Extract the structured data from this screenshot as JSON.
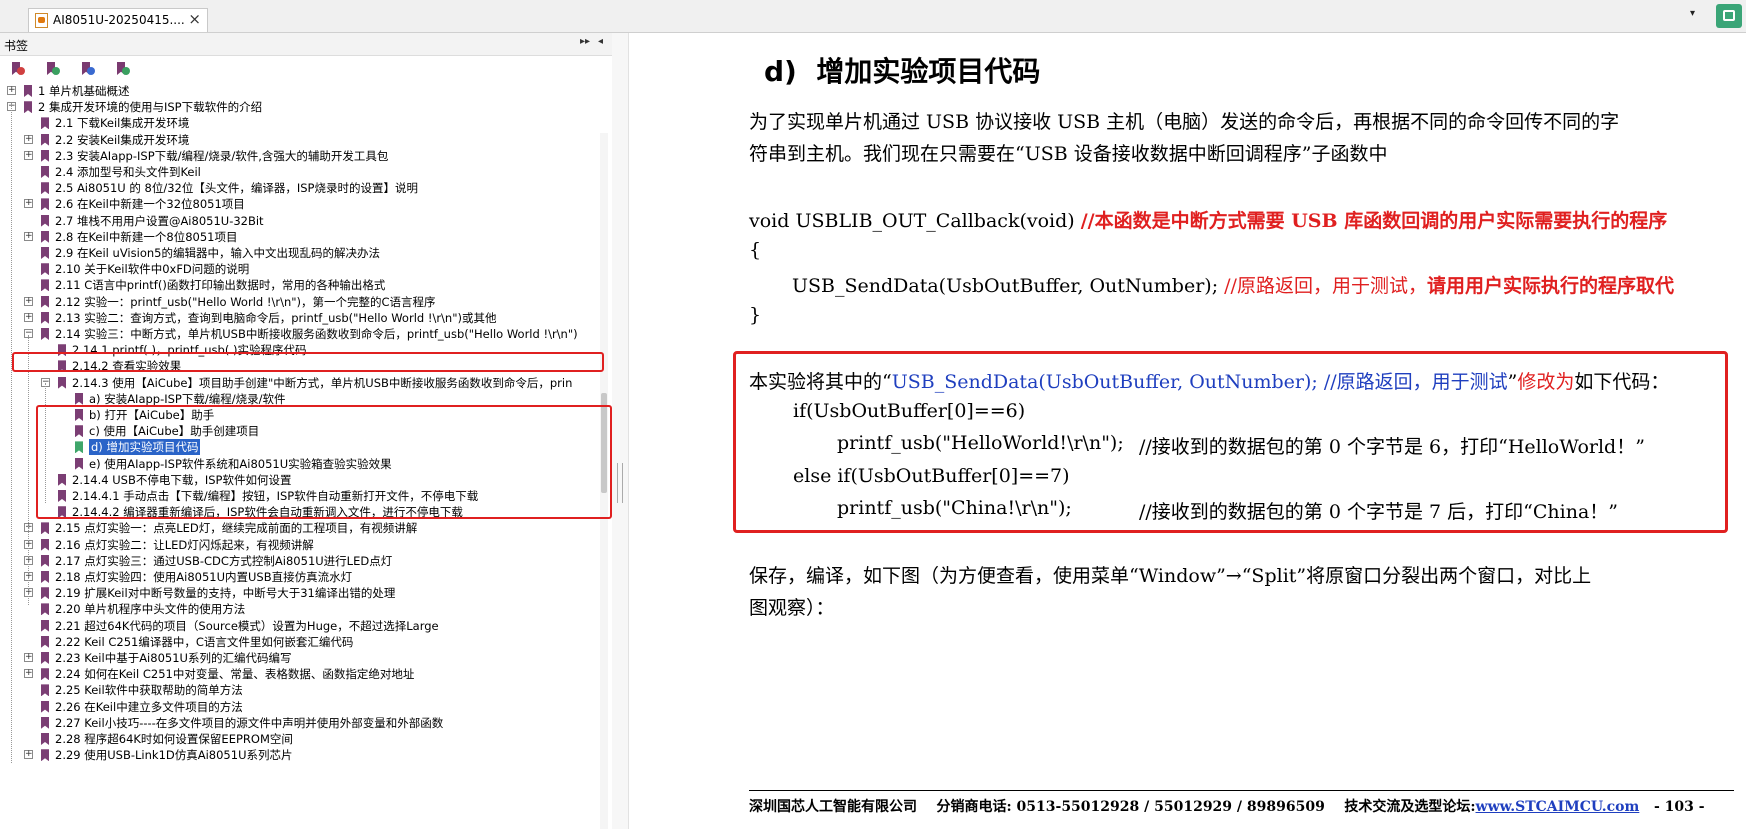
{
  "tab": {
    "title": "AI8051U-20250415....",
    "close": "×"
  },
  "tabbar_menu": "▾",
  "sidebar": {
    "title": "书签",
    "ctrl_expand": "▸▸",
    "ctrl_collapse": "◂",
    "tools": [
      "bookmark-options-icon",
      "bookmark-add-icon",
      "bookmark-expand-icon",
      "bookmark-find-icon"
    ],
    "items": [
      {
        "label": "1  单片机基础概述",
        "level": 0,
        "exp": "+"
      },
      {
        "label": "2  集成开发环境的使用与ISP下载软件的介绍",
        "level": 0,
        "exp": "-"
      },
      {
        "label": "2.1  下载Keil集成开发环境",
        "level": 1,
        "exp": ""
      },
      {
        "label": "2.2  安装Keil集成开发环境",
        "level": 1,
        "exp": "+"
      },
      {
        "label": "2.3  安装AIapp-ISP下载/编程/烧录/软件,含强大的辅助开发工具包",
        "level": 1,
        "exp": "+"
      },
      {
        "label": "2.4  添加型号和头文件到Keil",
        "level": 1,
        "exp": ""
      },
      {
        "label": "2.5  Ai8051U 的 8位/32位【头文件，编译器，ISP烧录时的设置】说明",
        "level": 1,
        "exp": ""
      },
      {
        "label": "2.6  在Keil中新建一个32位8051项目",
        "level": 1,
        "exp": "+"
      },
      {
        "label": "2.7  堆栈不用用户设置@Ai8051U-32Bit",
        "level": 1,
        "exp": ""
      },
      {
        "label": "2.8  在Keil中新建一个8位8051项目",
        "level": 1,
        "exp": "+"
      },
      {
        "label": "2.9  在Keil uVision5的编辑器中，输入中文出现乱码的解决办法",
        "level": 1,
        "exp": ""
      },
      {
        "label": "2.10  关于Keil软件中0xFD问题的说明",
        "level": 1,
        "exp": ""
      },
      {
        "label": "2.11  C语言中printf()函数打印输出数据时，常用的各种输出格式",
        "level": 1,
        "exp": ""
      },
      {
        "label": "2.12  实验一：printf_usb(\"Hello World !\\r\\n\")，第一个完整的C语言程序",
        "level": 1,
        "exp": "+"
      },
      {
        "label": "2.13  实验二：查询方式，查询到电脑命令后，printf_usb(\"Hello World !\\r\\n\")或其他",
        "level": 1,
        "exp": "+"
      },
      {
        "label": "2.14  实验三：中断方式，单片机USB中断接收服务函数收到命令后，printf_usb(\"Hello World !\\r\\n\")",
        "level": 1,
        "exp": "-"
      },
      {
        "label": "2.14.1 printf( )，printf_usb( )实验程序代码",
        "level": 2,
        "exp": ""
      },
      {
        "label": "2.14.2 查看实验效果",
        "level": 2,
        "exp": ""
      },
      {
        "label": "2.14.3  使用【AiCube】项目助手创建\"中断方式，单片机USB中断接收服务函数收到命令后，prin",
        "level": 2,
        "exp": "-"
      },
      {
        "label": "a) 安装AIapp-ISP下载/编程/烧录/软件",
        "level": 3,
        "exp": ""
      },
      {
        "label": "b) 打开【AiCube】助手",
        "level": 3,
        "exp": ""
      },
      {
        "label": "c) 使用【AiCube】助手创建项目",
        "level": 3,
        "exp": ""
      },
      {
        "label": "d) 增加实验项目代码",
        "level": 3,
        "exp": "",
        "selected": true
      },
      {
        "label": "e) 使用AIapp-ISP软件系统和Ai8051U实验箱查验实验效果",
        "level": 3,
        "exp": ""
      },
      {
        "label": "2.14.4  USB不停电下载，ISP软件如何设置",
        "level": 2,
        "exp": ""
      },
      {
        "label": "2.14.4.1 手动点击【下载/编程】按钮，ISP软件自动重新打开文件，不停电下载",
        "level": 2,
        "exp": ""
      },
      {
        "label": "2.14.4.2  编译器重新编译后，ISP软件会自动重新调入文件，进行不停电下载",
        "level": 2,
        "exp": ""
      },
      {
        "label": "2.15  点灯实验一：点亮LED灯，继续完成前面的工程项目，有视频讲解",
        "level": 1,
        "exp": "+"
      },
      {
        "label": "2.16  点灯实验二：让LED灯闪烁起来，有视频讲解",
        "level": 1,
        "exp": "+"
      },
      {
        "label": "2.17  点灯实验三：通过USB-CDC方式控制Ai8051U进行LED点灯",
        "level": 1,
        "exp": "+"
      },
      {
        "label": "2.18  点灯实验四：使用Ai8051U内置USB直接仿真流水灯",
        "level": 1,
        "exp": "+"
      },
      {
        "label": "2.19  扩展Keil对中断号数量的支持，中断号大于31编译出错的处理",
        "level": 1,
        "exp": "+"
      },
      {
        "label": "2.20  单片机程序中头文件的使用方法",
        "level": 1,
        "exp": ""
      },
      {
        "label": "2.21  超过64K代码的项目（Source模式）设置为Huge，不超过选择Large",
        "level": 1,
        "exp": ""
      },
      {
        "label": "2.22  Keil C251编译器中，C语言文件里如何嵌套汇编代码",
        "level": 1,
        "exp": ""
      },
      {
        "label": "2.23  Keil中基于Ai8051U系列的汇编代码编写",
        "level": 1,
        "exp": "+"
      },
      {
        "label": "2.24  如何在Keil C251中对变量、常量、表格数据、函数指定绝对地址",
        "level": 1,
        "exp": "+"
      },
      {
        "label": "2.25  Keil软件中获取帮助的简单方法",
        "level": 1,
        "exp": ""
      },
      {
        "label": "2.26  在Keil中建立多文件项目的方法",
        "level": 1,
        "exp": ""
      },
      {
        "label": "2.27  Keil小技巧----在多文件项目的源文件中声明并使用外部变量和外部函数",
        "level": 1,
        "exp": ""
      },
      {
        "label": "2.28  程序超64K时如何设置保留EEPROM空间",
        "level": 1,
        "exp": ""
      },
      {
        "label": "2.29  使用USB-Link1D仿真Ai8051U系列芯片",
        "level": 1,
        "exp": "+"
      }
    ]
  },
  "doc": {
    "heading_num": "d)",
    "heading_text": "增加实验项目代码",
    "para1_line1": "为了实现单片机通过 USB 协议接收 USB 主机（电脑）发送的命令后，再根据不同的命令回传不同的字",
    "para1_line2": "符串到主机。我们现在只需要在“USB 设备接收数据中断回调程序”子函数中",
    "code1_a": "void USBLIB_OUT_Callback(void) ",
    "code1_b": "//本函数是中断方式需要 USB 库函数回调的用户实际需要执行的程序",
    "brace_open": "{",
    "code2_a": "USB_SendData(UsbOutBuffer, OutNumber); ",
    "code2_b": "//原路返回，用于测试，",
    "code2_c": "请用用户实际执行的程序取代",
    "brace_close": "}",
    "box_a": "本实验将其中的“",
    "box_b": "USB_SendData(UsbOutBuffer, OutNumber); //原路返回，用于测试",
    "box_c": "”",
    "box_d": "修改为",
    "box_e": "如下代码：",
    "box_l2": "if(UsbOutBuffer[0]==6)",
    "box_l3a": "printf_usb(\"HelloWorld!\\r\\n\");",
    "box_l3b": "//接收到的数据包的第 0 个字节是 6，打印“HelloWorld！”",
    "box_l4": "else if(UsbOutBuffer[0]==7)",
    "box_l5a": "printf_usb(\"China!\\r\\n\");",
    "box_l5b": "//接收到的数据包的第 0 个字节是 7 后，打印“China！”",
    "para3_line1": "保存，编译，如下图（为方便查看，使用菜单“Window”→“Split”将原窗口分裂出两个窗口，对比上",
    "para3_line2": "图观察）：",
    "footer_company": "深圳国芯人工智能有限公司",
    "footer_phone": "分销商电话: 0513-55012928 / 55012929 / 89896509",
    "footer_forum": "技术交流及选型论坛:",
    "footer_url": "www.STCAIMCU.com",
    "footer_page": "- 103 -"
  },
  "colors": {
    "accent_red": "#e02020",
    "link_blue": "#1f3fbf",
    "selection": "#2a64c8",
    "bookmark": "#7b3e74"
  }
}
